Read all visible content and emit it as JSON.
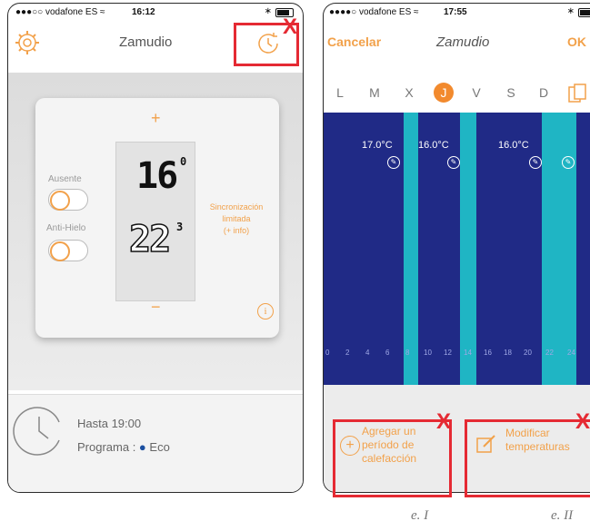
{
  "left_screen": {
    "status": {
      "carrier": "●●●○○ vodafone ES ≈",
      "time": "16:12"
    },
    "title": "Zamudio",
    "ausente_label": "Ausente",
    "antihielo_label": "Anti-Hielo",
    "plus": "+",
    "minus": "−",
    "setpoint_digits": "16",
    "setpoint_decimal": "0",
    "current_digits": "22",
    "current_decimal": "3",
    "sync_lines": [
      "Sincronización",
      "limitada",
      "(+ info)"
    ],
    "info": "i",
    "until": "Hasta 19:00",
    "program_prefix": "Programa : ",
    "program_dot": "●",
    "program_name": "Eco"
  },
  "right_screen": {
    "status": {
      "carrier": "●●●●○ vodafone ES ≈",
      "time": "17:55"
    },
    "cancel": "Cancelar",
    "title": "Zamudio",
    "ok": "OK",
    "days": [
      "L",
      "M",
      "X",
      "J",
      "V",
      "S",
      "D"
    ],
    "active_day": "J",
    "temp_labels": [
      "17.0°C",
      "16.0°C",
      "16.0°C"
    ],
    "hour_ticks": [
      "0",
      "2",
      "4",
      "6",
      "8",
      "10",
      "12",
      "14",
      "16",
      "18",
      "20",
      "22",
      "24"
    ],
    "add_period": [
      "Agregar un",
      "período de",
      "calefacción"
    ],
    "modify_temps": [
      "Modificar",
      "temperaturas"
    ]
  },
  "annotations": {
    "x_mark": "X",
    "caption_1": "e. I",
    "caption_2": "e. II"
  },
  "colors": {
    "accent_orange": "#f2a14a",
    "graph_blue": "#202a86",
    "heating_cyan": "#1fb5c4",
    "annotation_red": "#e52a33"
  }
}
